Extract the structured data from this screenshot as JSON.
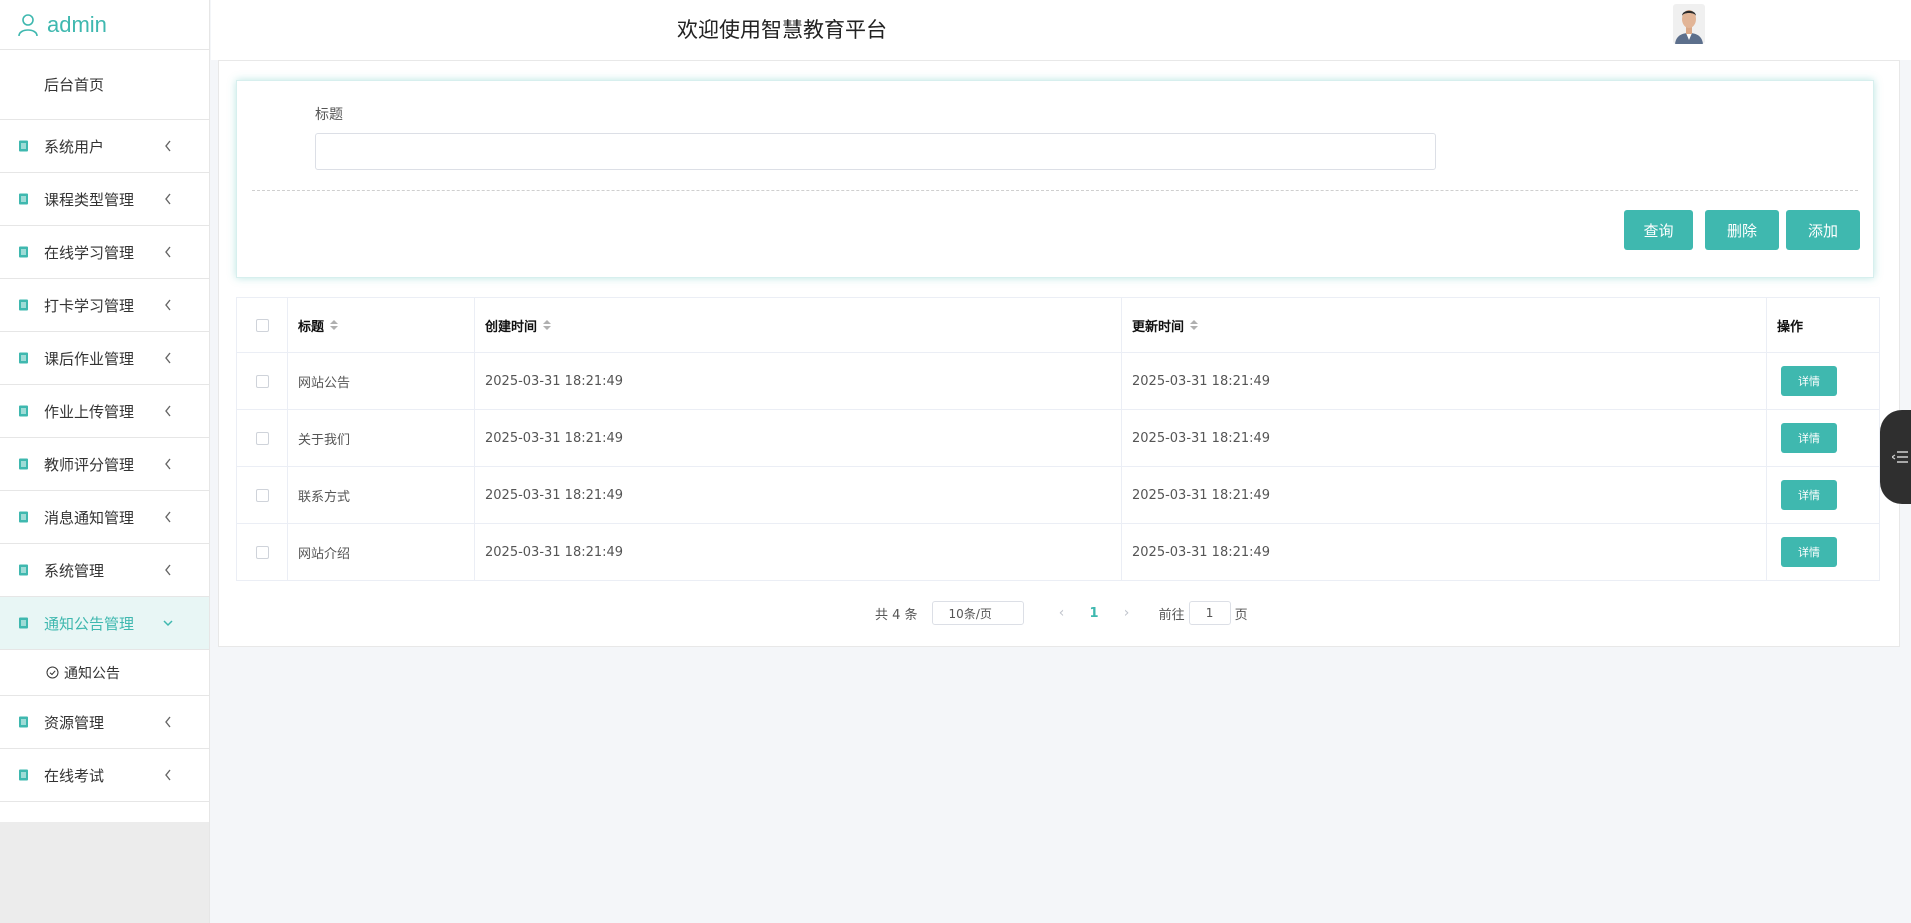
{
  "brand": {
    "name": "admin"
  },
  "header": {
    "title": "欢迎使用智慧教育平台"
  },
  "sidebar": {
    "home": "后台首页",
    "items": [
      {
        "label": "系统用户"
      },
      {
        "label": "课程类型管理"
      },
      {
        "label": "在线学习管理"
      },
      {
        "label": "打卡学习管理"
      },
      {
        "label": "课后作业管理"
      },
      {
        "label": "作业上传管理"
      },
      {
        "label": "教师评分管理"
      },
      {
        "label": "消息通知管理"
      },
      {
        "label": "系统管理"
      },
      {
        "label": "通知公告管理",
        "active": true
      },
      {
        "label": "资源管理"
      },
      {
        "label": "在线考试"
      }
    ],
    "sub_item": "通知公告"
  },
  "search": {
    "label": "标题",
    "value": ""
  },
  "buttons": {
    "query": "查询",
    "delete": "删除",
    "add": "添加"
  },
  "table": {
    "headers": [
      "标题",
      "创建时间",
      "更新时间",
      "操作"
    ],
    "rows": [
      {
        "title": "网站公告",
        "created": "2025-03-31 18:21:49",
        "updated": "2025-03-31 18:21:49",
        "action": "详情"
      },
      {
        "title": "关于我们",
        "created": "2025-03-31 18:21:49",
        "updated": "2025-03-31 18:21:49",
        "action": "详情"
      },
      {
        "title": "联系方式",
        "created": "2025-03-31 18:21:49",
        "updated": "2025-03-31 18:21:49",
        "action": "详情"
      },
      {
        "title": "网站介绍",
        "created": "2025-03-31 18:21:49",
        "updated": "2025-03-31 18:21:49",
        "action": "详情"
      }
    ]
  },
  "pagination": {
    "total": "共 4 条",
    "page_size": "10条/页",
    "current_page": "1",
    "goto_label": "前往",
    "goto_value": "1",
    "page_suffix": "页"
  },
  "colors": {
    "accent": "#3fb8af"
  }
}
